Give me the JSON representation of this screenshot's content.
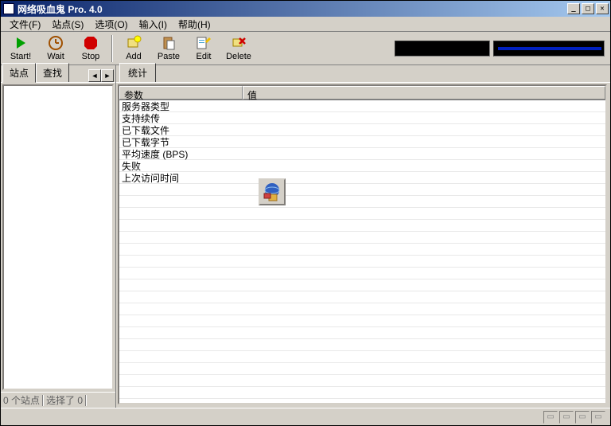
{
  "title": "网络吸血鬼  Pro. 4.0",
  "menus": {
    "file": "文件(F)",
    "site": "站点(S)",
    "options": "选项(O)",
    "input": "输入(I)",
    "help": "帮助(H)"
  },
  "toolbar": {
    "start": "Start!",
    "wait": "Wait",
    "stop": "Stop",
    "add": "Add",
    "paste": "Paste",
    "edit": "Edit",
    "delete": "Delete"
  },
  "left": {
    "tab_site": "站点",
    "tab_find": "查找",
    "status_sites": "0 个站点",
    "status_selected": "选择了 0"
  },
  "right": {
    "tab_stats": "统计",
    "col_param": "参数",
    "col_value": "值",
    "params": [
      "服务器类型",
      "支持续传",
      "已下载文件",
      "已下载字节",
      "平均速度 (BPS)",
      "失败",
      "上次访问时间"
    ]
  }
}
